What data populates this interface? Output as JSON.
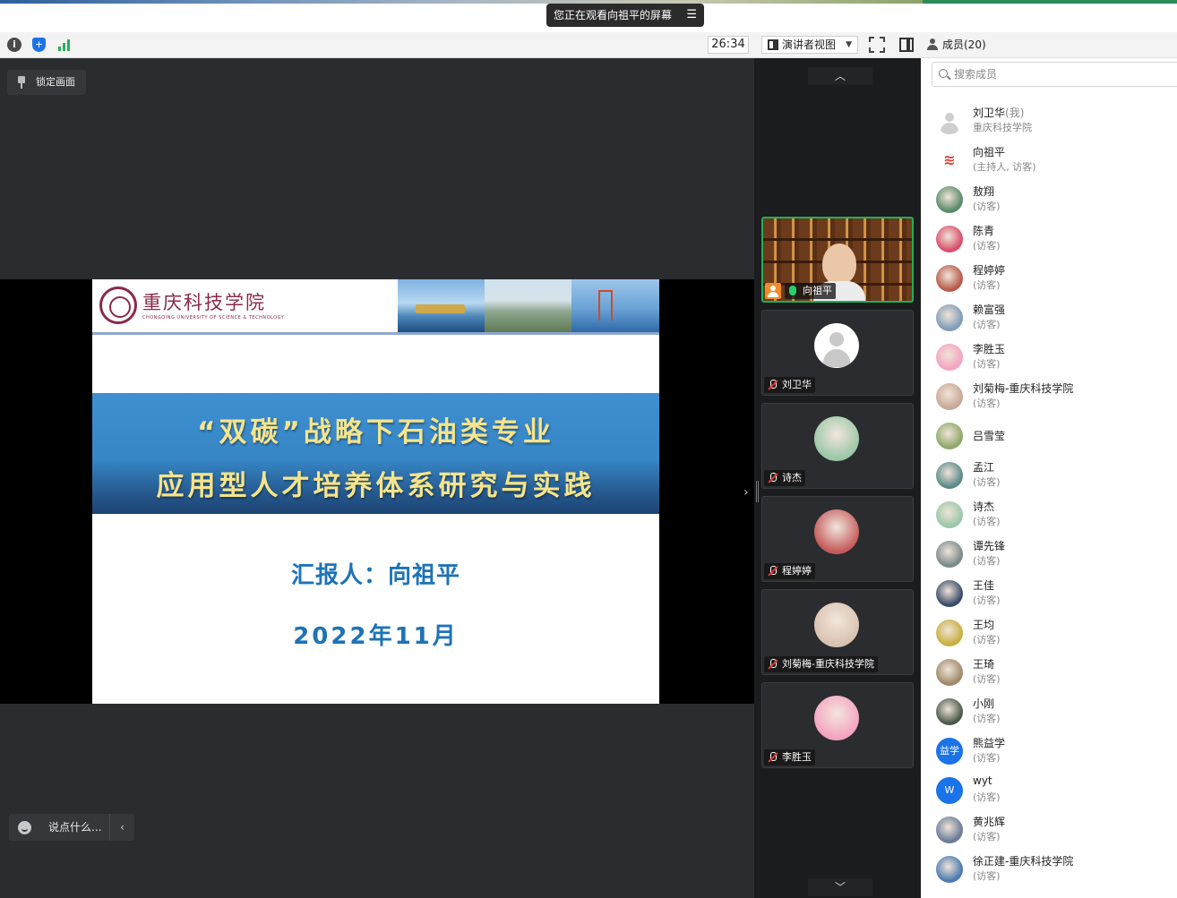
{
  "share_banner": {
    "text": "您正在观看向祖平的屏幕"
  },
  "toolbar": {
    "timer": "26:34",
    "view_mode": "演讲者视图"
  },
  "members_header": {
    "label": "成员(20)"
  },
  "stage": {
    "pin_label": "锁定画面",
    "chat_placeholder": "说点什么..."
  },
  "slide": {
    "university_cn": "重庆科技学院",
    "university_en": "CHONGQING UNIVERSITY OF SCIENCE & TECHNOLOGY",
    "title_line1": "“双碳”战略下石油类专业",
    "title_line2": "应用型人才培养体系研究与实践",
    "reporter": "汇报人：向祖平",
    "date": "2022年11月"
  },
  "gallery": {
    "tiles": [
      {
        "name": "向祖平",
        "type": "video",
        "mic": "on",
        "host": true
      },
      {
        "name": "刘卫华",
        "type": "avatar-default",
        "mic": "muted"
      },
      {
        "name": "诗杰",
        "type": "avatar-photo",
        "mic": "muted",
        "color": "#9bc7a8"
      },
      {
        "name": "程婷婷",
        "type": "avatar-photo",
        "mic": "muted",
        "color": "#c45a5a"
      },
      {
        "name": "刘菊梅-重庆科技学院",
        "type": "avatar-photo",
        "mic": "muted",
        "color": "#d8c2b0"
      },
      {
        "name": "李胜玉",
        "type": "avatar-photo",
        "mic": "muted",
        "color": "#f4a3c0"
      }
    ]
  },
  "members": {
    "search_placeholder": "搜索成员",
    "list": [
      {
        "name": "刘卫华",
        "suffix": "(我)",
        "role": "重庆科技学院",
        "avatar": "default",
        "color": "#e6e6e6"
      },
      {
        "name": "向祖平",
        "suffix": "",
        "role": "(主持人, 访客)",
        "avatar": "logo",
        "color": "#e23b2e"
      },
      {
        "name": "敖翔",
        "suffix": "",
        "role": "(访客)",
        "avatar": "photo",
        "color": "#5a8a6a"
      },
      {
        "name": "陈青",
        "suffix": "",
        "role": "(访客)",
        "avatar": "photo",
        "color": "#d94e6a"
      },
      {
        "name": "程婷婷",
        "suffix": "",
        "role": "(访客)",
        "avatar": "photo",
        "color": "#b85a4a"
      },
      {
        "name": "赖富强",
        "suffix": "",
        "role": "(访客)",
        "avatar": "photo",
        "color": "#7f9cb8"
      },
      {
        "name": "李胜玉",
        "suffix": "",
        "role": "(访客)",
        "avatar": "photo",
        "color": "#f4a3c0"
      },
      {
        "name": "刘菊梅-重庆科技学院",
        "suffix": "",
        "role": "(访客)",
        "avatar": "photo",
        "color": "#c9a896"
      },
      {
        "name": "吕雪莹",
        "suffix": "",
        "role": "",
        "avatar": "photo",
        "color": "#8fa86a"
      },
      {
        "name": "孟江",
        "suffix": "",
        "role": "(访客)",
        "avatar": "photo",
        "color": "#5a8a8a"
      },
      {
        "name": "诗杰",
        "suffix": "",
        "role": "(访客)",
        "avatar": "photo",
        "color": "#9bc7a8"
      },
      {
        "name": "谭先锋",
        "suffix": "",
        "role": "(访客)",
        "avatar": "photo",
        "color": "#7a8a8a"
      },
      {
        "name": "王佳",
        "suffix": "",
        "role": "(访客)",
        "avatar": "photo",
        "color": "#3a4a6a"
      },
      {
        "name": "王均",
        "suffix": "",
        "role": "(访客)",
        "avatar": "photo",
        "color": "#c8b040"
      },
      {
        "name": "王琦",
        "suffix": "",
        "role": "(访客)",
        "avatar": "photo",
        "color": "#a08a6a"
      },
      {
        "name": "小刚",
        "suffix": "",
        "role": "(访客)",
        "avatar": "photo",
        "color": "#4a5a4a"
      },
      {
        "name": "熊益学",
        "suffix": "",
        "role": "(访客)",
        "avatar": "initials",
        "initials": "益学",
        "color": "#1a73e8"
      },
      {
        "name": "wyt",
        "suffix": "",
        "role": "(访客)",
        "avatar": "initials",
        "initials": "W",
        "color": "#1a73e8"
      },
      {
        "name": "黄兆辉",
        "suffix": "",
        "role": "(访客)",
        "avatar": "photo",
        "color": "#6a7a9a"
      },
      {
        "name": "徐正建-重庆科技学院",
        "suffix": "",
        "role": "(访客)",
        "avatar": "photo",
        "color": "#4a7ab0"
      }
    ]
  },
  "colors": {
    "stage_bg": "#2a2c2f",
    "gallery_bg": "#1b1c1e",
    "active_border": "#1fb05a",
    "slide_title": "#f6e48a",
    "slide_text": "#1e73b7"
  }
}
